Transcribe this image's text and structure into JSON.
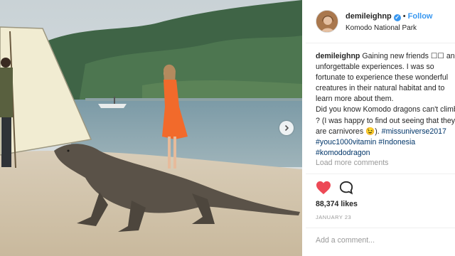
{
  "header": {
    "username": "demileighnp",
    "verified_icon": "verified-badge-icon",
    "separator": "•",
    "follow_label": "Follow",
    "location": "Komodo National Park"
  },
  "caption": {
    "username": "demileighnp",
    "line1": "Gaining new friends ☐☐ and",
    "line2": "unforgettable experiences. I was so",
    "line3": "fortunate to experience these wonderful",
    "line4": "creatures in their natural habitat and to",
    "line5": "learn more about them.",
    "line6": "Did you know Komodo dragons can't climb",
    "line7": "? (I was happy to find out seeing that they",
    "line8_text": "are carnivores 😉). ",
    "hashtags": [
      "#missuniverse2017",
      "#youc1000vitamin",
      "#Indonesia",
      "#komododragon"
    ]
  },
  "load_more_label": "Load more comments",
  "likes": "88,374 likes",
  "date": "JANUARY 23",
  "add_comment_placeholder": "Add a comment...",
  "icons": {
    "like": "heart-icon",
    "comment": "comment-icon",
    "next": "chevron-right-icon"
  },
  "colors": {
    "link_blue": "#3897f0",
    "hashtag": "#003569",
    "heart_red": "#ed4956",
    "muted": "#999999",
    "text": "#262626"
  }
}
